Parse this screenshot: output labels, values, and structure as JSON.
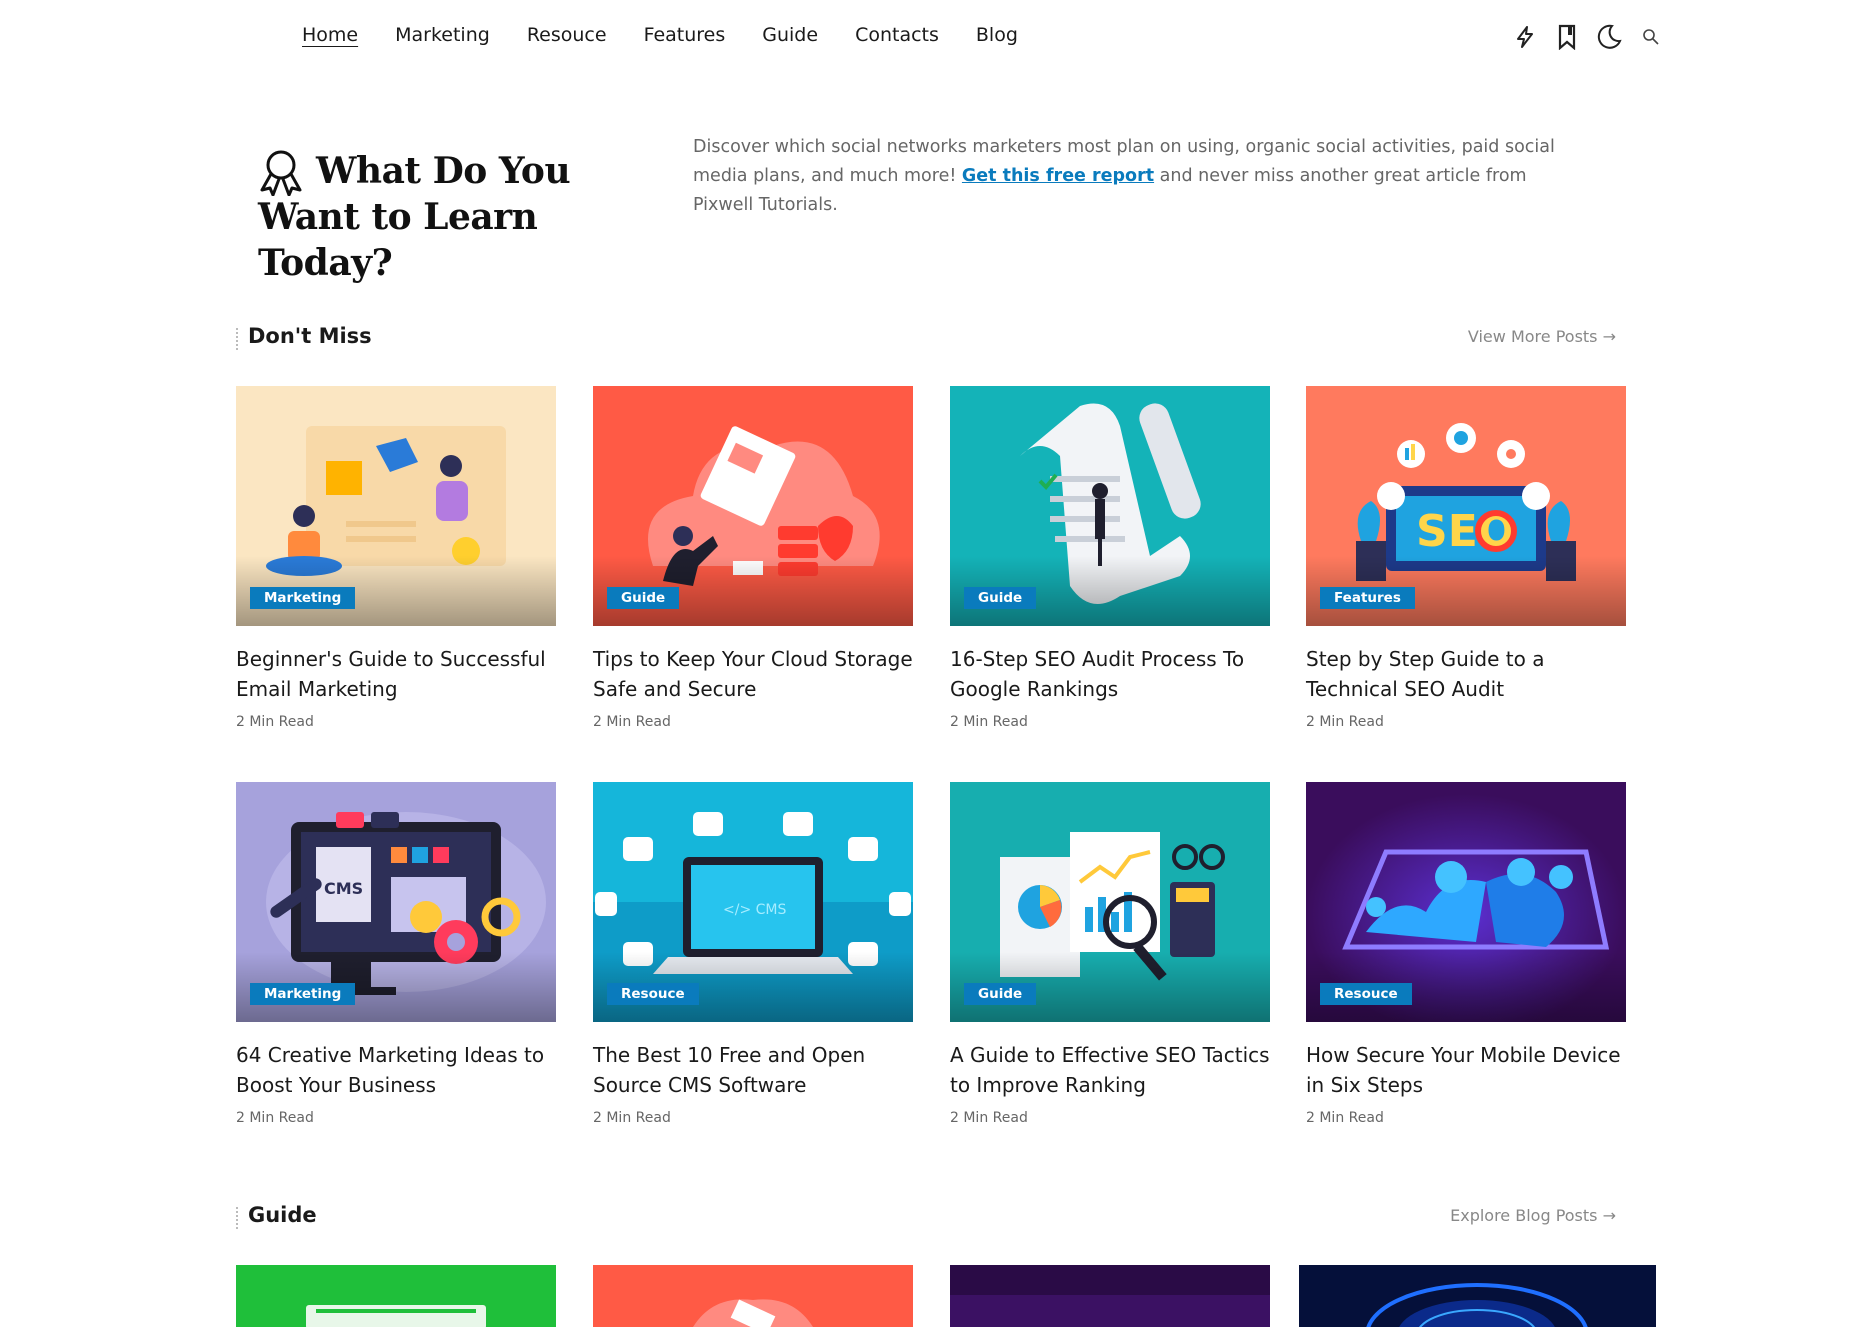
{
  "nav": {
    "items": [
      {
        "label": "Home"
      },
      {
        "label": "Marketing"
      },
      {
        "label": "Resouce"
      },
      {
        "label": "Features"
      },
      {
        "label": "Guide"
      },
      {
        "label": "Contacts"
      },
      {
        "label": "Blog"
      }
    ],
    "icons": [
      "lightning-icon",
      "bookmark-icon",
      "moon-icon",
      "search-icon"
    ]
  },
  "hero": {
    "title_line1": "What Do You",
    "title_line2": "Want to Learn Today?",
    "desc_before": "Discover which social networks marketers most plan on using, organic social activities, paid social media plans, and much more! ",
    "desc_link": "Get this free report",
    "desc_after": " and never miss another great article from Pixwell Tutorials."
  },
  "dont_miss": {
    "title": "Don't Miss",
    "more": "View More Posts →",
    "cards": [
      {
        "category": "Marketing",
        "title": "Beginner's Guide to Successful Email Marketing",
        "meta": "2 Min Read"
      },
      {
        "category": "Guide",
        "title": "Tips to Keep Your Cloud Storage Safe and Secure",
        "meta": "2 Min Read"
      },
      {
        "category": "Guide",
        "title": "16-Step SEO Audit Process To Google Rankings",
        "meta": "2 Min Read"
      },
      {
        "category": "Features",
        "title": "Step by Step Guide to a Technical SEO Audit",
        "meta": "2 Min Read"
      },
      {
        "category": "Marketing",
        "title": "64 Creative Marketing Ideas to Boost Your Business",
        "meta": "2 Min Read"
      },
      {
        "category": "Resouce",
        "title": "The Best 10 Free and Open Source CMS Software",
        "meta": "2 Min Read"
      },
      {
        "category": "Guide",
        "title": "A Guide to Effective SEO Tactics to Improve Ranking",
        "meta": "2 Min Read"
      },
      {
        "category": "Resouce",
        "title": "How Secure Your Mobile Device in Six Steps",
        "meta": "2 Min Read"
      }
    ]
  },
  "guide": {
    "title": "Guide",
    "more": "Explore Blog Posts →"
  },
  "colors": {
    "accent": "#0a7bbd",
    "thumb_email": "#fbe6c2",
    "thumb_cloud": "#ff5a45",
    "thumb_seo_audit": "#14b3b8",
    "thumb_tech_seo": "#ff7a5e",
    "thumb_cms_ideas": "#a6a2dc",
    "thumb_cms_laptop": "#15b6da",
    "thumb_seo_tactics": "#17aeaf",
    "thumb_mobile": "#3a0d5c"
  }
}
